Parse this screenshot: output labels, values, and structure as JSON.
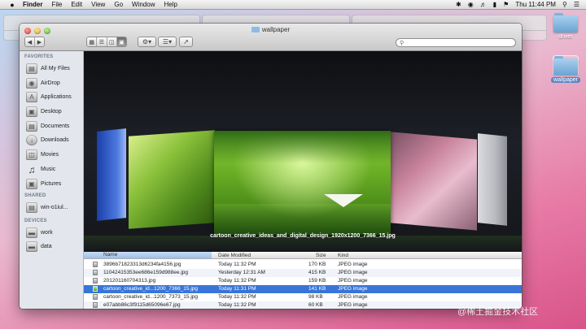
{
  "menubar": {
    "apple": "",
    "app": "Finder",
    "items": [
      "File",
      "Edit",
      "View",
      "Go",
      "Window",
      "Help"
    ],
    "clock": "Thu 11:44 PM"
  },
  "desktop": {
    "icons": [
      {
        "label": "driver"
      },
      {
        "label": "wallpaper"
      }
    ]
  },
  "window": {
    "title": "wallpaper",
    "search_placeholder": ""
  },
  "sidebar": {
    "favorites_header": "FAVORITES",
    "favorites": [
      "All My Files",
      "AirDrop",
      "Applications",
      "Desktop",
      "Documents",
      "Downloads",
      "Movies",
      "Music",
      "Pictures"
    ],
    "shared_header": "SHARED",
    "shared": [
      "win-o1iul..."
    ],
    "devices_header": "DEVICES",
    "devices": [
      "work",
      "data"
    ]
  },
  "coverflow": {
    "caption": "cartoon_creative_ideas_and_digital_design_1920x1200_7366_15.jpg"
  },
  "list": {
    "columns": {
      "name": "Name",
      "date": "Date Modified",
      "size": "Size",
      "kind": "Kind"
    },
    "rows": [
      {
        "name": "3896b71823313d6234fa4156.jpg",
        "date": "Today 11:32 PM",
        "size": "170 KB",
        "kind": "JPEG image"
      },
      {
        "name": "11042415353ee686e159d988ee.jpg",
        "date": "Yesterday 12:31 AM",
        "size": "415 KB",
        "kind": "JPEG image"
      },
      {
        "name": "201201160704313.jpg",
        "date": "Today 11:32 PM",
        "size": "159 KB",
        "kind": "JPEG image"
      },
      {
        "name": "cartoon_creative_id...1200_7366_15.jpg",
        "date": "Today 11:31 PM",
        "size": "141 KB",
        "kind": "JPEG image",
        "selected": true
      },
      {
        "name": "cartoon_creative_id...1200_7373_15.jpg",
        "date": "Today 11:32 PM",
        "size": "98 KB",
        "kind": "JPEG image"
      },
      {
        "name": "e07abb86c3f9115d65096e67.jpg",
        "date": "Today 11:32 PM",
        "size": "60 KB",
        "kind": "JPEG image"
      }
    ]
  },
  "watermark": "@稀土掘金技术社区"
}
